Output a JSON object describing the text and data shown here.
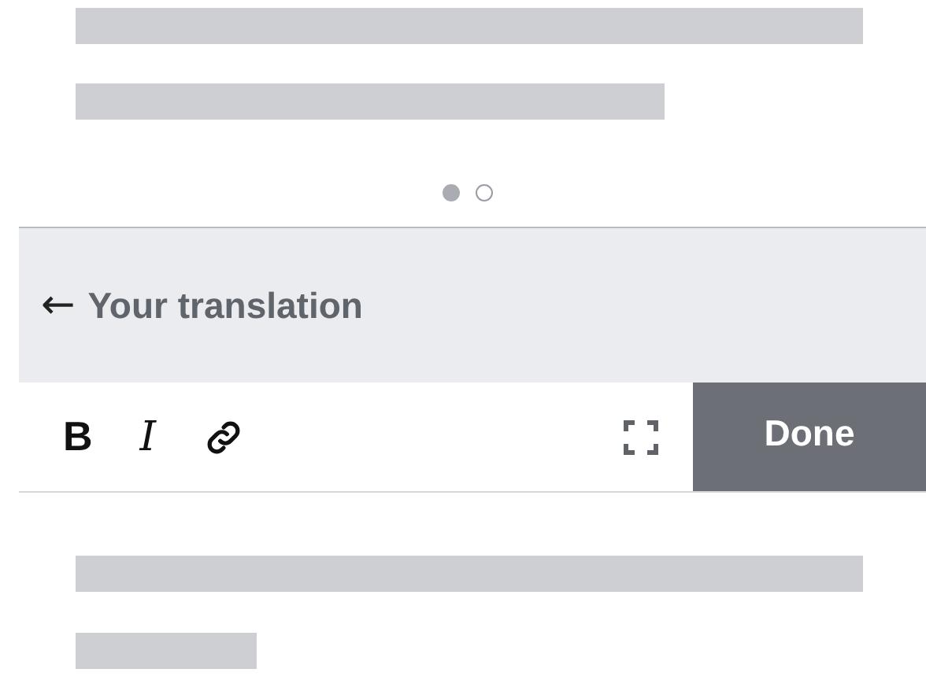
{
  "pager": {
    "dots": [
      {
        "selected": true
      },
      {
        "selected": false
      }
    ]
  },
  "header": {
    "back_icon": "←",
    "title": "Your translation"
  },
  "toolbar": {
    "format_buttons": [
      {
        "kind": "bold",
        "label": "B"
      },
      {
        "kind": "italic",
        "label": "I"
      },
      {
        "kind": "link"
      }
    ],
    "done_button": "Done"
  }
}
